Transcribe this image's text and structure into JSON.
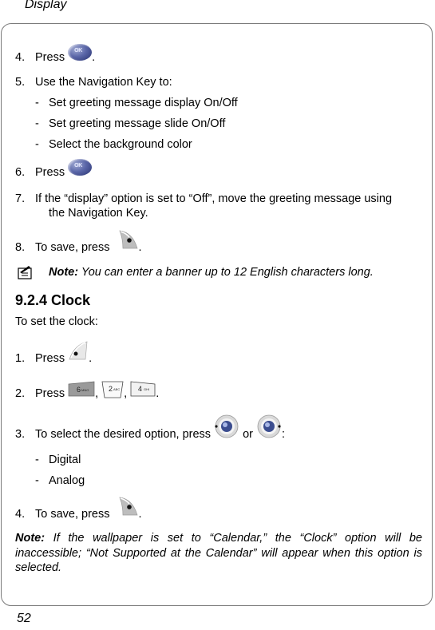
{
  "header": {
    "section": "Display"
  },
  "steps_part1": [
    {
      "num": "4.",
      "text": "Press",
      "icon": "ok-key-icon",
      "suffix": "."
    },
    {
      "num": "5.",
      "text": "Use the Navigation Key to:"
    },
    {
      "num": "6.",
      "text": "Press",
      "icon": "ok-key-icon",
      "suffix": ""
    },
    {
      "num": "7.",
      "text": "If the “display” option is set to “Off”, move the greeting message using",
      "continuation": "the Navigation Key."
    },
    {
      "num": "8.",
      "text": "To save, press",
      "icon": "left-soft-key-icon",
      "suffix": "."
    }
  ],
  "step5_subitems": [
    "Set greeting message display On/Off",
    "Set greeting message slide On/Off",
    "Select the background color"
  ],
  "dash": "-",
  "ok_label": "OK",
  "note1": {
    "label": "Note:",
    "text": " You can enter a banner up to 12 English characters long."
  },
  "section": {
    "title": "9.2.4 Clock",
    "intro": "To set the clock:"
  },
  "steps_part2": [
    {
      "num": "1.",
      "text": "Press",
      "icon": "left-soft-key-icon",
      "suffix": "."
    },
    {
      "num": "2.",
      "text": "Press",
      "keys": [
        "6 MNO",
        "2 ABC",
        "4 GHI"
      ],
      "separator": ",",
      "suffix": "."
    },
    {
      "num": "3.",
      "text": "To select the desired option, press",
      "or": "or",
      "suffix": ":"
    },
    {
      "num": "4.",
      "text": "To save, press",
      "icon": "left-soft-key-icon",
      "suffix": "."
    }
  ],
  "step3_options": [
    "Digital",
    "Analog"
  ],
  "note2": {
    "label": "Note:",
    "text": " If the wallpaper is set to “Calendar,” the “Clock” option will be inaccessible; “Not Supported at the Calendar” will appear when this option is selected."
  },
  "footer": {
    "page_number": "52"
  }
}
